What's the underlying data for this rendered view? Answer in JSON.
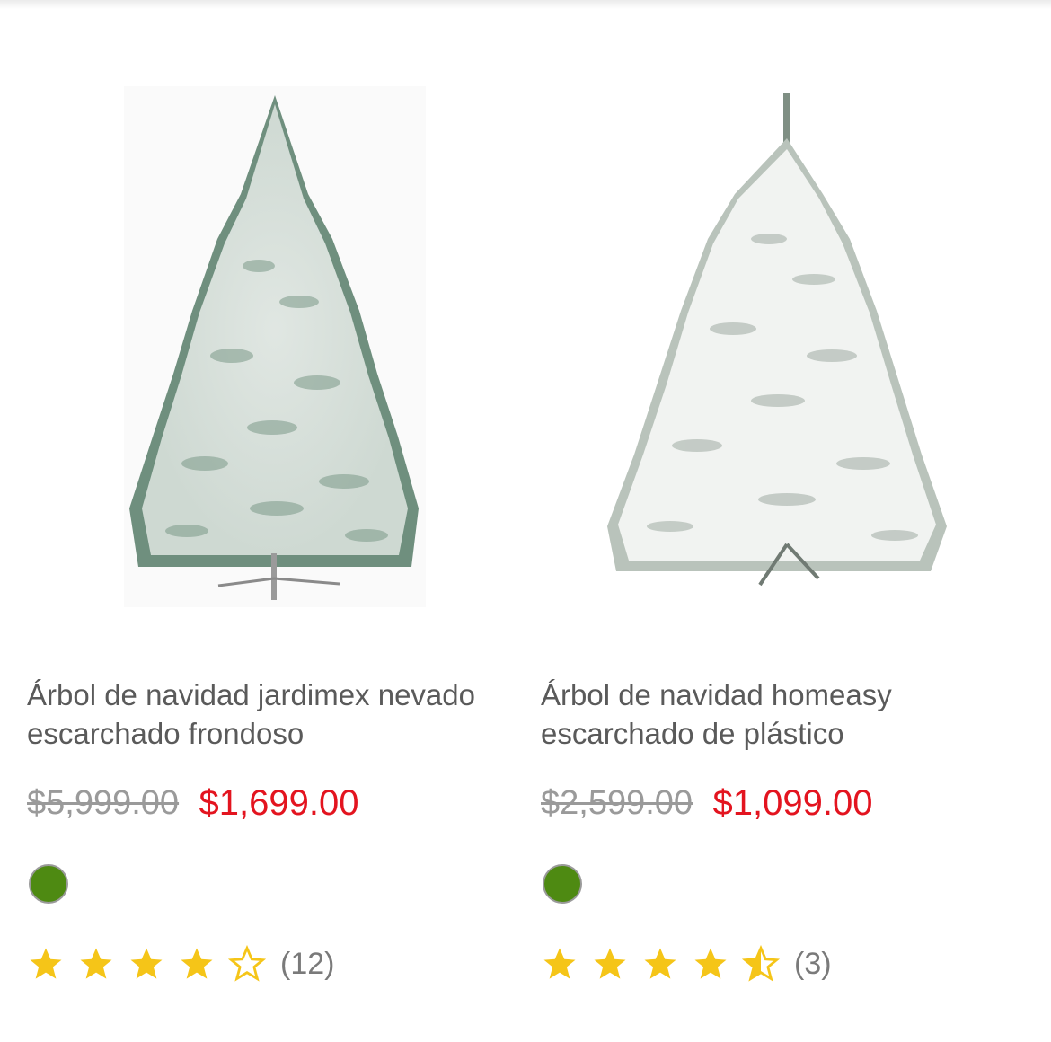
{
  "colors": {
    "accent_price": "#e3141f",
    "old_price": "#9a9a9a",
    "star": "#f5c518",
    "swatch_green": "#4e8a12"
  },
  "products": [
    {
      "title": "Árbol de navidad jardimex nevado escarchado frondoso",
      "old_price": "$5,999.00",
      "price": "$1,699.00",
      "color_swatch": "green",
      "rating": 4,
      "review_count": "(12)",
      "image_icon": "flocked-christmas-tree-image"
    },
    {
      "title": "Árbol de navidad homeasy escarchado de plástico",
      "old_price": "$2,599.00",
      "price": "$1,099.00",
      "color_swatch": "green",
      "rating": 4.5,
      "review_count": "(3)",
      "image_icon": "flocked-christmas-tree-image"
    }
  ]
}
